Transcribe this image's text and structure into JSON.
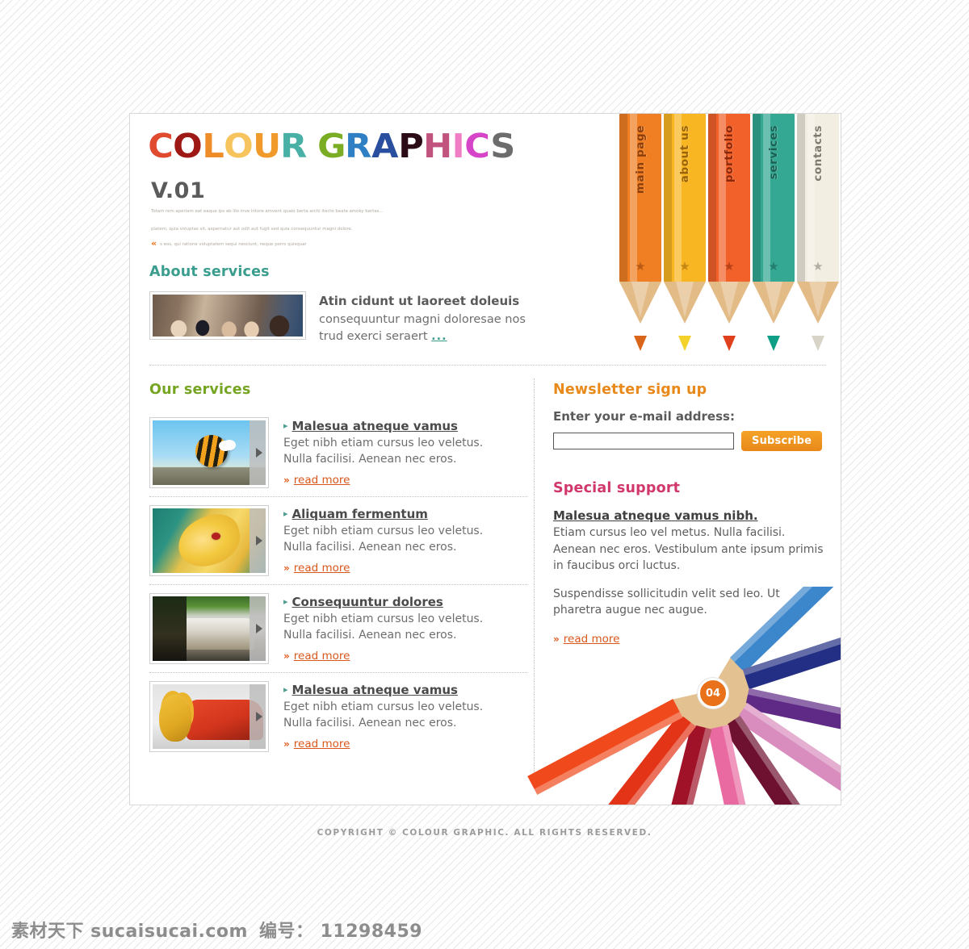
{
  "site": {
    "logo_words": [
      {
        "char": "C",
        "color": "#e04a2f"
      },
      {
        "char": "O",
        "color": "#9e1916"
      },
      {
        "char": "L",
        "color": "#ef8c2a"
      },
      {
        "char": "O",
        "color": "#f6c35c"
      },
      {
        "char": "U",
        "color": "#f09a2c"
      },
      {
        "char": "R",
        "color": "#48b0a4"
      },
      {
        "char": "G",
        "color": "#7aac24"
      },
      {
        "char": "R",
        "color": "#2e7fc4"
      },
      {
        "char": "A",
        "color": "#2a4f9e"
      },
      {
        "char": "P",
        "color": "#2a0b16"
      },
      {
        "char": "H",
        "color": "#c0547e"
      },
      {
        "char": "I",
        "color": "#f07ec4"
      },
      {
        "char": "C",
        "color": "#d645c8"
      },
      {
        "char": "S",
        "color": "#6c6c6c"
      }
    ],
    "logo_text": "COLOUR GRAPHICS",
    "version": "V.01",
    "intro_line_1": "Totam rem aperiam eat eaque ips ab illo inve intore amvent quaio berta archi itecto beate amoky bertas...",
    "intro_line_2": "platem, quia voluptas sit, aspernatur aut odit aut fugit sed quia consequuntur magni dolore.",
    "intro_quote_marker": "«",
    "intro_line_3": "s eos, qui ratione voluptatem sequi nesciunt, neque porro quisquar"
  },
  "nav": {
    "items": [
      {
        "label": "main page",
        "barrel_color": "#ef7f22",
        "label_color": "#8d3d0a",
        "tip_color": "#d9651a",
        "star": "★"
      },
      {
        "label": "about us",
        "barrel_color": "#f8b622",
        "label_color": "#9a6206",
        "tip_color": "#f2d22a",
        "star": "★"
      },
      {
        "label": "portfolio",
        "barrel_color": "#f2612a",
        "label_color": "#8c2708",
        "tip_color": "#e0401c",
        "star": "★"
      },
      {
        "label": "services",
        "barrel_color": "#34a893",
        "label_color": "#1a5f52",
        "tip_color": "#0f9f86",
        "star": "★"
      },
      {
        "label": "contacts",
        "barrel_color": "#f3eee2",
        "label_color": "#7f7a70",
        "tip_color": "#d9d4c8",
        "star": "★"
      }
    ]
  },
  "about": {
    "title": "About services",
    "headline": "Atin cidunt ut laoreet doleuis",
    "body_line_1": "consequuntur magni doloresae nos",
    "body_line_2": "trud exerci seraert",
    "more_dots": "..."
  },
  "services": {
    "title": "Our services",
    "items": [
      {
        "title": "Malesua atneque vamus",
        "desc_line_1": "Eget nibh etiam cursus leo veletus.",
        "desc_line_2": "Nulla facilisi. Aenean nec eros.",
        "read_more": "read more",
        "thumb_alt": "bee-illustration"
      },
      {
        "title": "Aliquam fermentum",
        "desc_line_1": "Eget nibh etiam cursus leo veletus.",
        "desc_line_2": "Nulla facilisi. Aenean nec eros.",
        "read_more": "read more",
        "thumb_alt": "lily-flower-illustration"
      },
      {
        "title": "Consequuntur dolores",
        "desc_line_1": "Eget nibh etiam cursus leo veletus.",
        "desc_line_2": "Nulla facilisi. Aenean nec eros.",
        "read_more": "read more",
        "thumb_alt": "waterfall-photo"
      },
      {
        "title": "Malesua atneque vamus",
        "desc_line_1": "Eget nibh etiam cursus leo veletus.",
        "desc_line_2": "Nulla facilisi. Aenean nec eros.",
        "read_more": "read more",
        "thumb_alt": "mouse-and-car-illustration"
      }
    ],
    "bullet": "▸",
    "read_more_arrows": "»"
  },
  "newsletter": {
    "title": "Newsletter sign up",
    "label": "Enter your e-mail address:",
    "email_value": "",
    "email_placeholder": "",
    "subscribe_label": "Subscribe"
  },
  "support": {
    "title": "Special support",
    "headline": "Malesua atneque vamus nibh.",
    "paragraph_1": "Etiam cursus leo vel metus. Nulla facilisi. Aenean nec eros. Vestibulum ante ipsum primis in faucibus orci luctus.",
    "paragraph_2": "Suspendisse sollicitudin velit sed leo. Ut pharetra augue nec augue.",
    "read_more": "read more"
  },
  "decor": {
    "badge_number": "04",
    "fan_pencils": [
      {
        "angle": -44,
        "color": "#3c86cc",
        "lead": "#2a6cab"
      },
      {
        "angle": -18,
        "color": "#232f84",
        "lead": "#1a2468"
      },
      {
        "angle": 12,
        "color": "#5e2a86",
        "lead": "#47205f"
      },
      {
        "angle": 34,
        "color": "#d88dbe",
        "lead": "#b56a9b"
      },
      {
        "angle": 56,
        "color": "#6e1030",
        "lead": "#4f0a21"
      },
      {
        "angle": 78,
        "color": "#e86aa0",
        "lead": "#c44a80"
      },
      {
        "angle": 104,
        "color": "#a01228",
        "lead": "#75091a"
      },
      {
        "angle": 128,
        "color": "#e33417",
        "lead": "#b5200c"
      },
      {
        "angle": 152,
        "color": "#f04a1c",
        "lead": "#c02f0e"
      }
    ]
  },
  "footer": {
    "copyright": "COPYRIGHT © COLOUR GRAPHIC. ALL RIGHTS RESERVED."
  },
  "watermark": {
    "site": "素材天下 sucaisucai.com",
    "id_label": "编号： 11298459"
  }
}
